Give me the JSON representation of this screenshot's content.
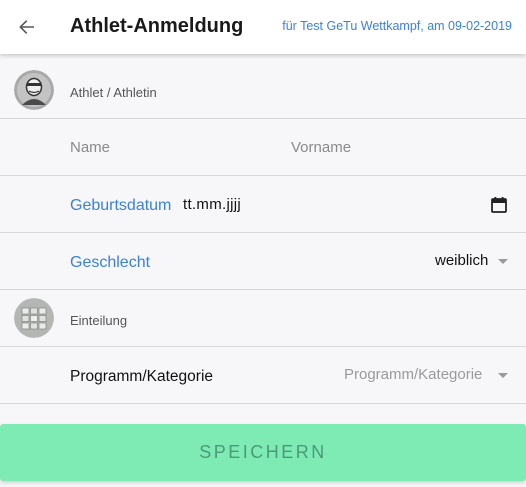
{
  "header": {
    "title": "Athlet-Anmeldung",
    "subtitle": "für Test GeTu Wettkampf, am 09-02-2019",
    "back_icon": "arrow-left-icon"
  },
  "sections": {
    "athlete": {
      "label": "Athlet / Athletin",
      "icon": "athlete-avatar-icon"
    },
    "division": {
      "label": "Einteilung",
      "icon": "division-grid-icon"
    }
  },
  "fields": {
    "name": {
      "placeholder": "Name"
    },
    "vorname": {
      "placeholder": "Vorname"
    },
    "birthdate": {
      "label": "Geburtsdatum",
      "value": "tt.mm.jjjj",
      "icon": "calendar-icon"
    },
    "gender": {
      "label": "Geschlecht",
      "value": "weiblich"
    },
    "program": {
      "label": "Programm/Kategorie",
      "placeholder": "Programm/Kategorie"
    }
  },
  "actions": {
    "save_label": "SPEICHERN"
  },
  "colors": {
    "accent": "#3b82d6",
    "save_button": "#7eebb5"
  }
}
